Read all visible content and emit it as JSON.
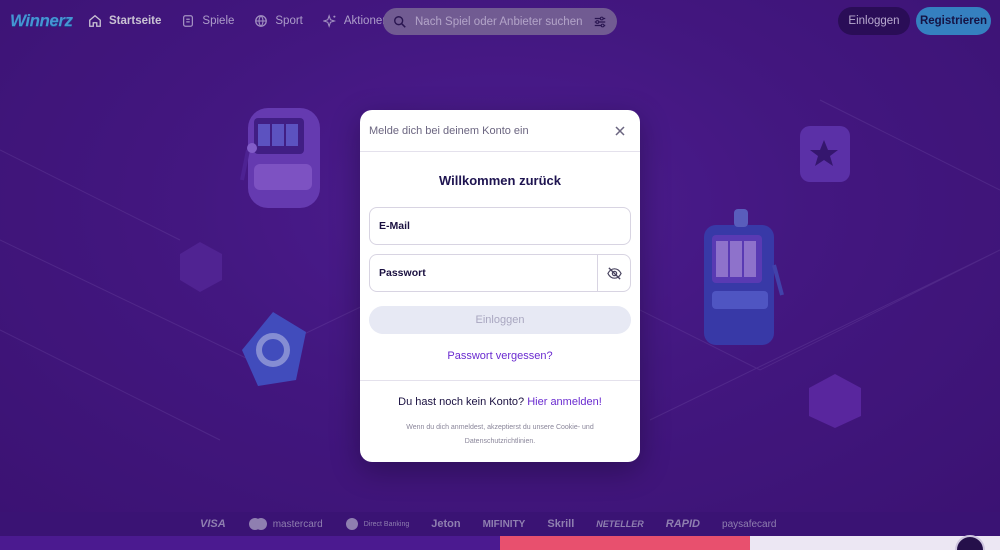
{
  "brand": {
    "logo_text": "Winnerz",
    "accent": "#4fc3ff",
    "primary": "#3aa7e6"
  },
  "nav": {
    "items": [
      {
        "label": "Startseite",
        "icon": "home-icon",
        "active": true
      },
      {
        "label": "Spiele",
        "icon": "games-icon",
        "active": false
      },
      {
        "label": "Sport",
        "icon": "sport-icon",
        "active": false
      },
      {
        "label": "Aktionen",
        "icon": "sparkle-icon",
        "active": false
      }
    ],
    "search": {
      "placeholder": "Nach Spiel oder Anbieter suchen"
    },
    "login_label": "Einloggen",
    "register_label": "Registrieren"
  },
  "modal": {
    "header_text": "Melde dich bei deinem Konto ein",
    "title": "Willkommen zurück",
    "email_label": "E-Mail",
    "password_label": "Passwort",
    "submit_label": "Einloggen",
    "forgot_label": "Passwort vergessen?",
    "no_account_text": "Du hast noch kein Konto?",
    "signup_link": "Hier anmelden!",
    "legal_text": "Wenn du dich anmeldest, akzeptierst du unsere Cookie- und Datenschutzrichtlinien."
  },
  "payments": [
    "VISA",
    "mastercard",
    "Direct Banking",
    "Jeton",
    "MIFINITY",
    "Skrill",
    "NETELLER",
    "RAPID",
    "paysafecard"
  ]
}
